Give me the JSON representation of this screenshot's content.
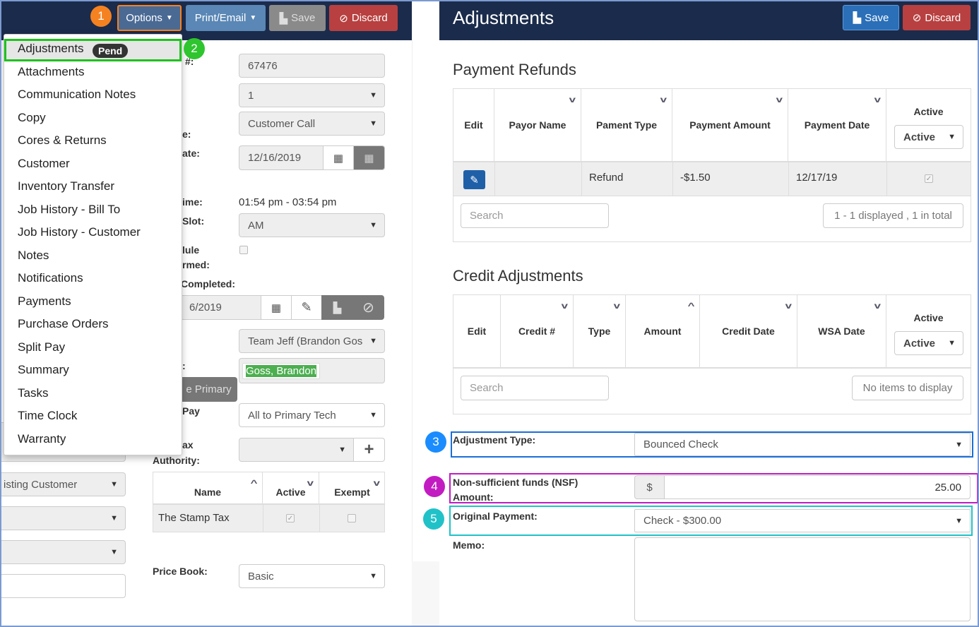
{
  "colors": {
    "header": "#1b2b4b",
    "primary": "#2a6fb8",
    "danger": "#b84040",
    "badge1": "#f58220",
    "badge2": "#2ec52e",
    "badge3": "#1a8cff",
    "badge4": "#c21bc2",
    "badge5": "#20c2c8"
  },
  "left": {
    "toolbar": {
      "options": "Options",
      "print_email": "Print/Email",
      "save": "Save",
      "discard": "Discard"
    },
    "badges": [
      "1",
      "2"
    ],
    "menu": {
      "items": [
        "Adjustments",
        "Attachments",
        "Communication Notes",
        "Copy",
        "Cores & Returns",
        "Customer",
        "Inventory Transfer",
        "Job History - Bill To",
        "Job History - Customer",
        "Notes",
        "Notifications",
        "Payments",
        "Purchase Orders",
        "Split Pay",
        "Summary",
        "Tasks",
        "Time Clock",
        "Warranty"
      ],
      "pend_badge": "Pend"
    },
    "labels": {
      "num": "#:",
      "e": "e:",
      "ate": "ate:",
      "ime": "ime:",
      "slot": "Slot:",
      "lule": "lule",
      "rmed": "rmed:",
      "completed": "Completed:",
      "colon": ":",
      "pay": "Pay",
      "ax": "ax",
      "authority": "Authority:",
      "price_book": "Price Book:"
    },
    "fields": {
      "number": "67476",
      "select1": "1",
      "source": "Customer Call",
      "date": "12/16/2019",
      "time": "01:54 pm - 03:54 pm",
      "slot": "AM",
      "completed_date": "6/2019",
      "team": "Team Jeff (Brandon Gos",
      "tech_tag": "Goss, Brandon",
      "primary_btn": "e Primary",
      "split": "All to Primary Tech",
      "tax_authority": "",
      "price_book": "Basic",
      "existing_customer": "isting Customer"
    },
    "tax_table": {
      "headers": [
        "Name",
        "Active",
        "Exempt"
      ],
      "rows": [
        {
          "name": "The Stamp Tax",
          "active": true,
          "exempt": false
        }
      ]
    }
  },
  "right": {
    "title": "Adjustments",
    "save": "Save",
    "discard": "Discard",
    "refunds": {
      "title": "Payment Refunds",
      "headers": [
        "Edit",
        "Payor Name",
        "Pament Type",
        "Payment Amount",
        "Payment Date",
        "Active"
      ],
      "active_filter": "Active",
      "rows": [
        {
          "payor": "",
          "type": "Refund",
          "amount": "-$1.50",
          "date": "12/17/19",
          "active": true
        }
      ],
      "search_placeholder": "Search",
      "count": "1 - 1 displayed , 1 in total"
    },
    "credits": {
      "title": "Credit Adjustments",
      "headers": [
        "Edit",
        "Credit #",
        "Type",
        "Amount",
        "Credit Date",
        "WSA Date",
        "Active"
      ],
      "active_filter": "Active",
      "search_placeholder": "Search",
      "count": "No items to display"
    },
    "badges": [
      "3",
      "4",
      "5"
    ],
    "adjustment_type": {
      "label": "Adjustment Type:",
      "value": "Bounced Check"
    },
    "nsf": {
      "label1": "Non-sufficient funds (NSF)",
      "label2": "Amount:",
      "currency": "$",
      "value": "25.00"
    },
    "original_payment": {
      "label": "Original Payment:",
      "value": "Check - $300.00"
    },
    "memo": {
      "label": "Memo:",
      "value": ""
    }
  }
}
